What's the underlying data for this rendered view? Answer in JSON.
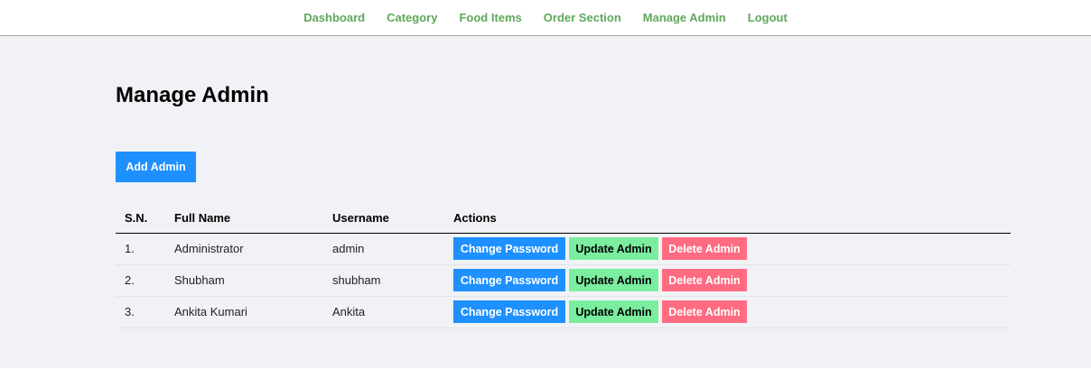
{
  "nav": {
    "items": [
      "Dashboard",
      "Category",
      "Food Items",
      "Order Section",
      "Manage Admin",
      "Logout"
    ]
  },
  "page": {
    "title": "Manage Admin",
    "add_button": "Add Admin"
  },
  "table": {
    "headers": [
      "S.N.",
      "Full Name",
      "Username",
      "Actions"
    ],
    "rows": [
      {
        "sn": "1.",
        "full_name": "Administrator",
        "username": "admin"
      },
      {
        "sn": "2.",
        "full_name": "Shubham",
        "username": "shubham"
      },
      {
        "sn": "3.",
        "full_name": "Ankita Kumari",
        "username": "Ankita"
      }
    ],
    "actions": {
      "change_password": "Change Password",
      "update_admin": "Update Admin",
      "delete_admin": "Delete Admin"
    }
  },
  "colors": {
    "nav_link": "#5ea85b",
    "primary": "#1e90ff",
    "update": "#7bed9f",
    "delete": "#ff6b81",
    "background": "#f1f2f6"
  }
}
